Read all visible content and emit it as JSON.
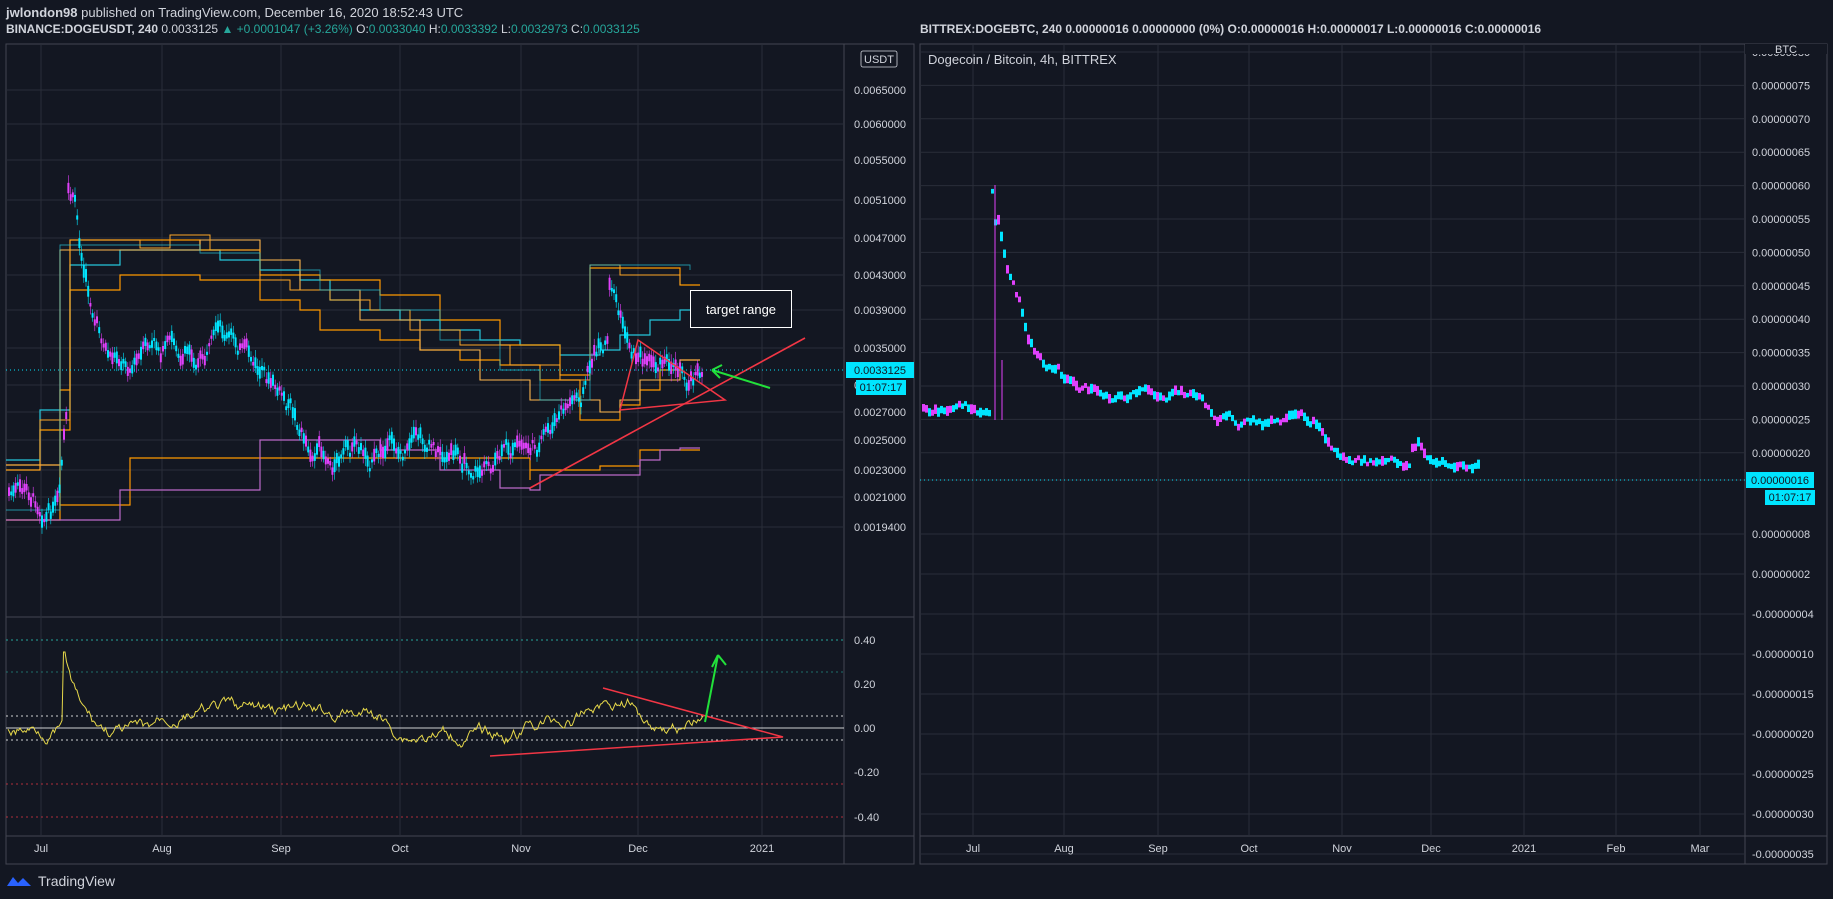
{
  "header": {
    "user": "jwlondon98",
    "published": "published on TradingView.com, December 16, 2020 18:52:43 UTC"
  },
  "left_legend": {
    "symbol": "BINANCE:DOGEUSDT, 240",
    "price": "0.0033125",
    "change": "▲ +0.0001047 (+3.26%)",
    "o_label": "O:",
    "o": "0.0033040",
    "h_label": "H:",
    "h": "0.0033392",
    "l_label": "L:",
    "l": "0.0032973",
    "c_label": "C:",
    "c": "0.0033125"
  },
  "right_legend": {
    "text": "BITTREX:DOGEBTC, 240  0.00000016  0.00000000 (0%)  O:0.00000016  H:0.00000017  L:0.00000016  C:0.00000016"
  },
  "right_title": "Dogecoin / Bitcoin, 4h, BITTREX",
  "annotation": "target range",
  "left_axis": {
    "currency_badge": "USDT",
    "ticks": [
      "0.0065000",
      "0.0060000",
      "0.0055000",
      "0.0051000",
      "0.0047000",
      "0.0043000",
      "0.0039000",
      "0.0035000",
      "0.0029000",
      "0.0027000",
      "0.0025000",
      "0.0023000",
      "0.0021000",
      "0.0019400"
    ],
    "price_tag": "0.0033125",
    "timer_tag": "01:07:17",
    "osc_ticks": [
      "0.40",
      "0.20",
      "0.00",
      "-0.20",
      "-0.40"
    ],
    "time_ticks": [
      "Jul",
      "Aug",
      "Sep",
      "Oct",
      "Nov",
      "Dec",
      "2021"
    ]
  },
  "right_axis": {
    "currency_badge": "BTC",
    "ticks": [
      "0.00000080",
      "0.00000075",
      "0.00000070",
      "0.00000065",
      "0.00000060",
      "0.00000055",
      "0.00000050",
      "0.00000045",
      "0.00000040",
      "0.00000035",
      "0.00000030",
      "0.00000025",
      "0.00000020",
      "0.00000016",
      "0.00000008",
      "0.00000002",
      "-0.00000004",
      "-0.00000010",
      "-0.00000015",
      "-0.00000020",
      "-0.00000025",
      "-0.00000030",
      "-0.00000035"
    ],
    "price_tag": "0.00000016",
    "timer_tag": "01:07:17",
    "time_ticks": [
      "Jul",
      "Aug",
      "Sep",
      "Oct",
      "Nov",
      "Dec",
      "2021",
      "Feb",
      "Mar"
    ]
  },
  "footer": {
    "brand": "TradingView"
  },
  "colors": {
    "bg": "#131722",
    "grid": "#2a2e39",
    "text": "#d1d4dc",
    "cyan": "#00e5ff",
    "magenta": "#e040fb",
    "orange": "#ff9800",
    "teal_band": "#26c6da",
    "purple_band": "#ba68c8",
    "red": "#f23645",
    "green": "#22e03a",
    "yellow": "#e6d84a"
  }
}
